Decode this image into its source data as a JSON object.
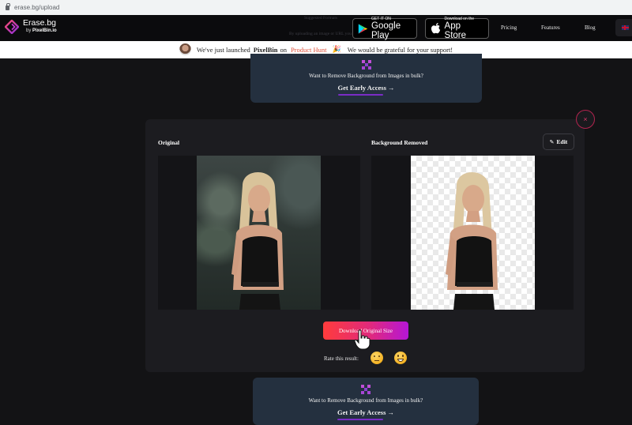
{
  "browser": {
    "url": "erase.bg/upload",
    "lock_icon": "lock-icon"
  },
  "header": {
    "brand_name": "Erase.bg",
    "brand_sub_prefix": "by ",
    "brand_sub_name": "PixelBin.io",
    "ghost_text_1": "Suggested Formats",
    "ghost_text_2": "By uploading an image or URL you",
    "google_play": {
      "small": "GET IT ON",
      "big": "Google Play"
    },
    "app_store": {
      "small": "Download on the",
      "big": "App Store"
    },
    "nav": [
      {
        "label": "Pricing"
      },
      {
        "label": "Features"
      },
      {
        "label": "Blog"
      }
    ],
    "language_icon": "uk-flag-icon"
  },
  "announcement": {
    "prefix": "We've just launched",
    "product": "PixelBin",
    "on": "on",
    "link": "Product Hunt",
    "emoji": "🎉",
    "suffix": "We would be grateful for your support!"
  },
  "bulk_promo": {
    "question": "Want to Remove Background from Images in bulk?",
    "cta": "Get Early Access →"
  },
  "result": {
    "original_label": "Original",
    "removed_label": "Background Removed",
    "edit_label": "Edit",
    "close_label": "×",
    "download_label": "Download Original Size",
    "rate_label": "Rate this result:",
    "rating_options": [
      "😔",
      "😀"
    ]
  },
  "colors": {
    "accent_gradient_start": "#ff3c3c",
    "accent_gradient_end": "#b516d6",
    "promo_bg": "#24303f",
    "product_hunt": "#e0533d",
    "close_ring": "#b3244f"
  }
}
